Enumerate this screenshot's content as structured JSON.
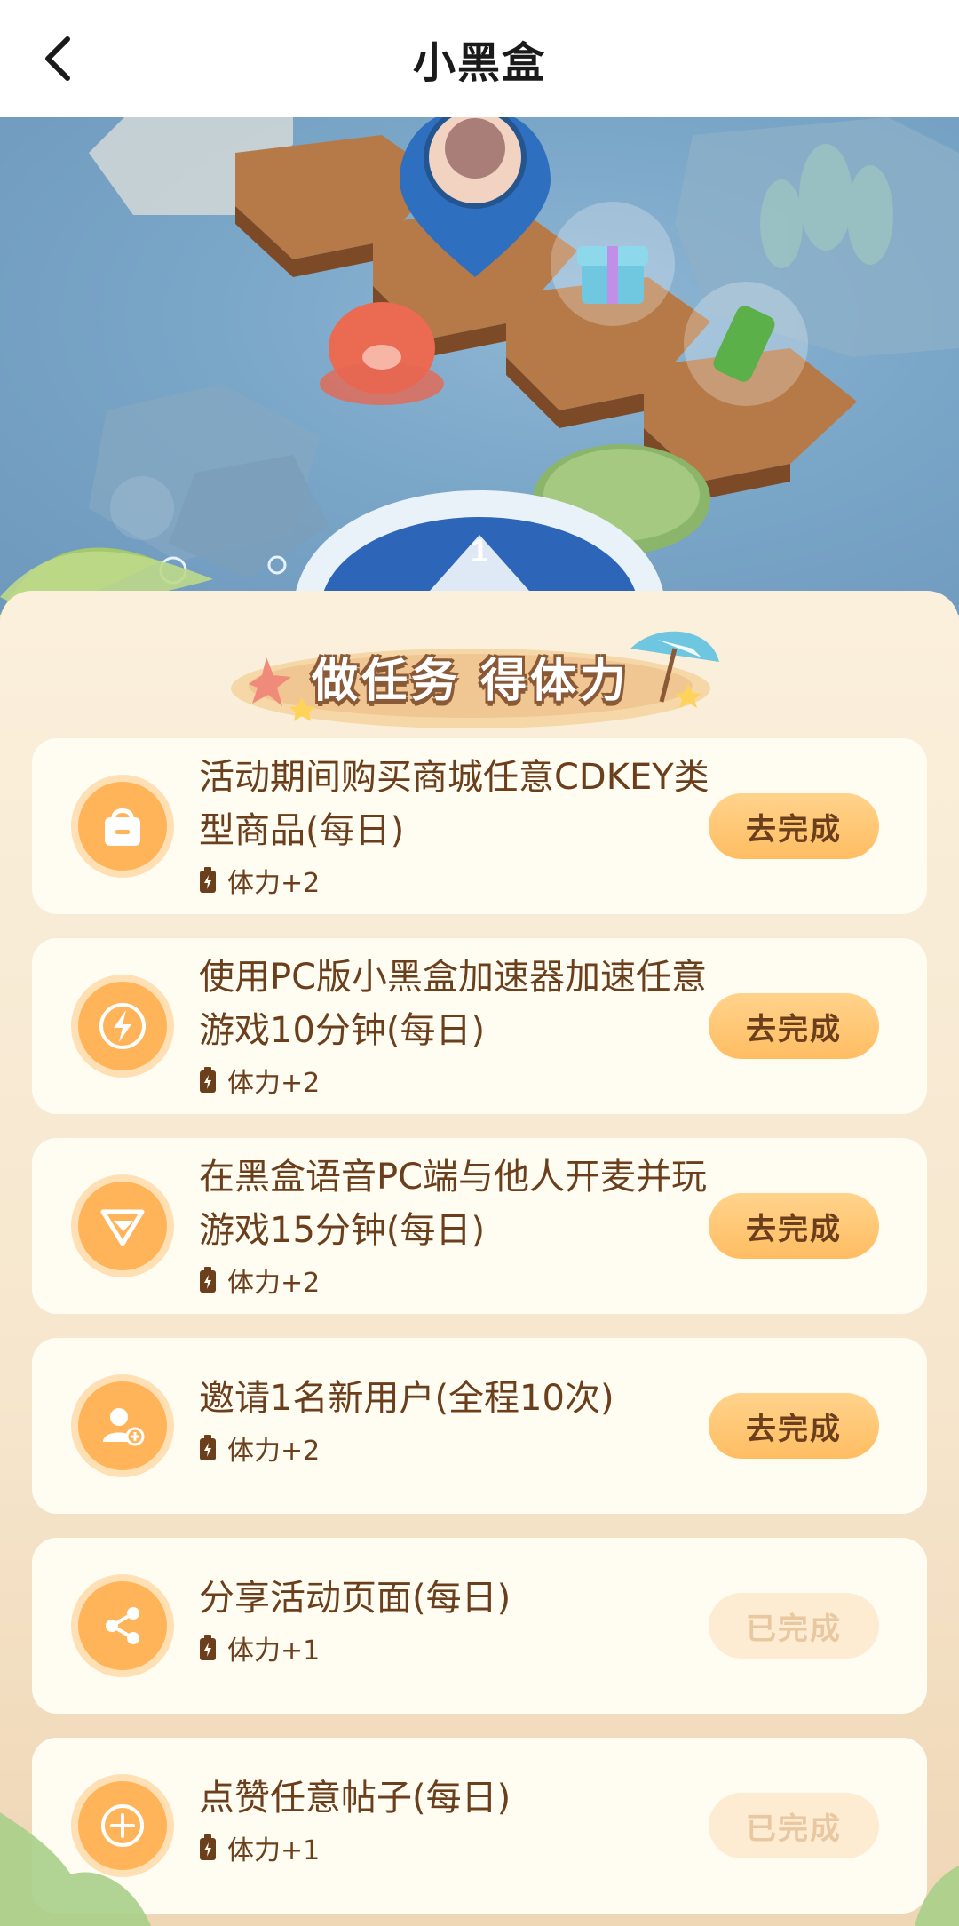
{
  "header": {
    "title": "小黑盒"
  },
  "scene": {
    "dice_number": "1"
  },
  "banner": {
    "title": "做任务 得体力"
  },
  "colors": {
    "accent": "#ffb45a",
    "text_brown": "#6b3e1c",
    "card_bg": "#fffcf2",
    "done_text": "#e8c8a0"
  },
  "tasks": [
    {
      "icon": "shopping-bag-icon",
      "title": "活动期间购买商城任意CDKEY类型商品(每日)",
      "reward": "体力+2",
      "button": "去完成",
      "completed": false
    },
    {
      "icon": "lightning-icon",
      "title": "使用PC版小黑盒加速器加速任意游戏10分钟(每日)",
      "reward": "体力+2",
      "button": "去完成",
      "completed": false
    },
    {
      "icon": "voice-logo-icon",
      "title": "在黑盒语音PC端与他人开麦并玩游戏15分钟(每日)",
      "reward": "体力+2",
      "button": "去完成",
      "completed": false
    },
    {
      "icon": "add-user-icon",
      "title": "邀请1名新用户(全程10次)",
      "reward": "体力+2",
      "button": "去完成",
      "completed": false
    },
    {
      "icon": "share-icon",
      "title": "分享活动页面(每日)",
      "reward": "体力+1",
      "button": "已完成",
      "completed": true
    },
    {
      "icon": "plus-circle-icon",
      "title": "点赞任意帖子(每日)",
      "reward": "体力+1",
      "button": "已完成",
      "completed": true
    }
  ]
}
